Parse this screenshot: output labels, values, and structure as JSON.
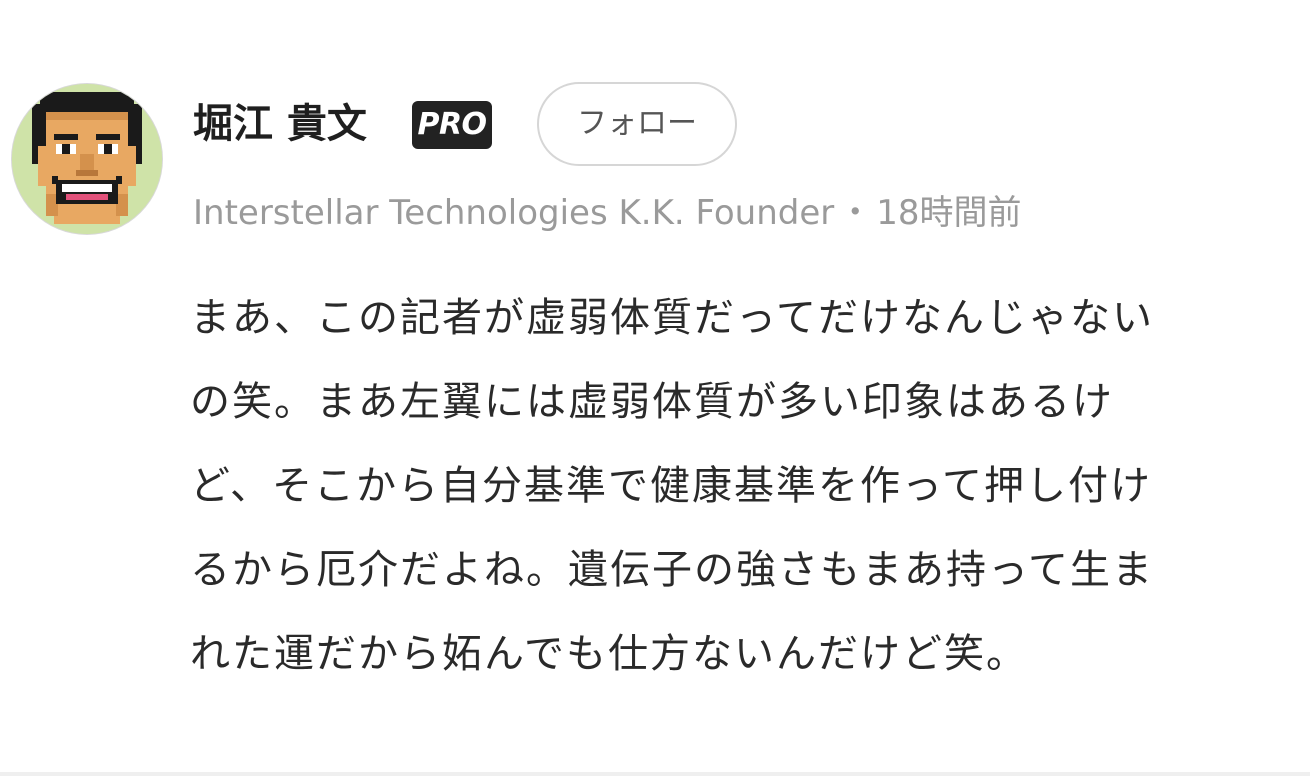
{
  "author": {
    "name": "堀江 貴文",
    "badge": "PRO",
    "affiliation": "Interstellar Technologies K.K. Founder",
    "separator": "・",
    "timestamp": "18時間前"
  },
  "follow_button": {
    "label": "フォロー"
  },
  "comment": {
    "lines": [
      "まあ、この記者が虚弱体質だってだけなんじゃない",
      "の笑。まあ左翼には虚弱体質が多い印象はあるけ",
      "ど、そこから自分基準で健康基準を作って押し付け",
      "るから厄介だよね。遺伝子の強さもまあ持って生ま",
      "れた運だから妬んでも仕方ないんだけど笑。"
    ]
  },
  "avatar": {
    "icon": "pixel-art-smiling-man-avatar",
    "background_color": "#cfe3a8"
  },
  "colors": {
    "name": "#1f1f1f",
    "badge_bg": "#222222",
    "meta": "#9a9a9a",
    "body": "#2a2a2a",
    "button_border": "#d6d6d6"
  }
}
